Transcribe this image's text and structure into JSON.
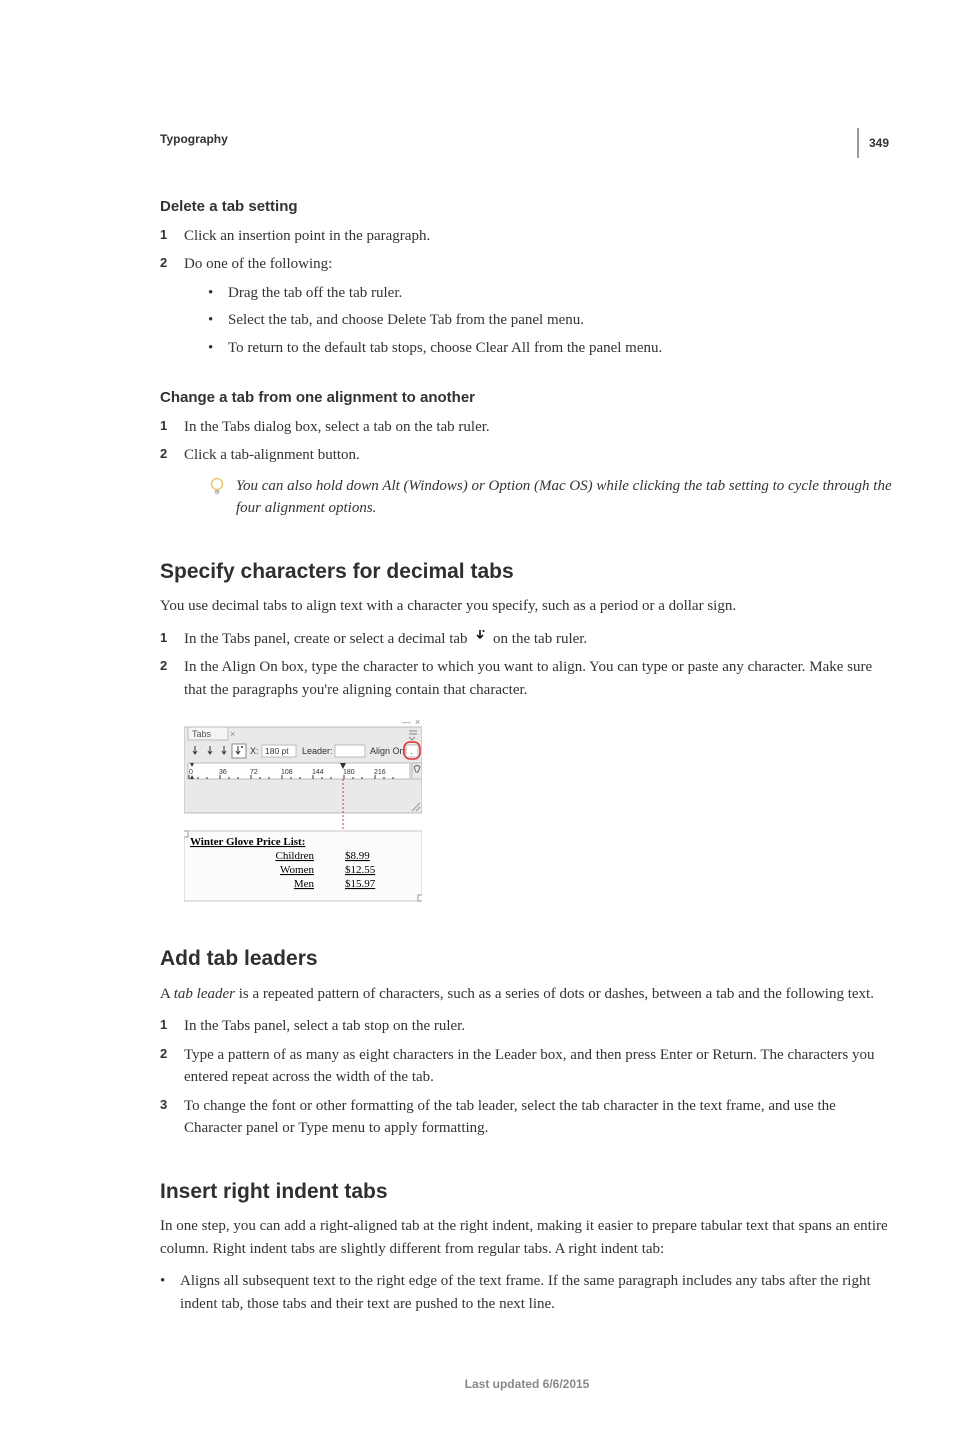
{
  "pageNumber": "349",
  "breadcrumb": "Typography",
  "s1": {
    "title": "Delete a tab setting",
    "step1": "Click an insertion point in the paragraph.",
    "step2": "Do one of the following:",
    "b1": "Drag the tab off the tab ruler.",
    "b2": "Select the tab, and choose Delete Tab from the panel menu.",
    "b3": "To return to the default tab stops, choose Clear All from the panel menu."
  },
  "s2": {
    "title": "Change a tab from one alignment to another",
    "step1": "In the Tabs dialog box, select a tab on the tab ruler.",
    "step2": "Click a tab-alignment button.",
    "tip": "You can also hold down Alt (Windows) or Option (Mac OS) while clicking the tab setting to cycle through the four alignment options."
  },
  "s3": {
    "title": "Specify characters for decimal tabs",
    "intro": "You use decimal tabs to align text with a character you specify, such as a period or a dollar sign.",
    "step1a": "In the Tabs panel, create or select a decimal tab ",
    "step1b": " on the tab ruler.",
    "step2": "In the Align On box, type the character to which you want to align. You can type or paste any character. Make sure that the paragraphs you're aligning contain that character.",
    "panel": {
      "tabLabel": "Tabs",
      "xLabel": "X:",
      "xValue": "180 pt",
      "leaderLabel": "Leader:",
      "alignOnLabel": "Align On:",
      "alignOnValue": ".",
      "ticks": [
        "0",
        "36",
        "72",
        "108",
        "144",
        "180",
        "216"
      ],
      "previewTitle": "Winter Glove Price List:",
      "rows": [
        {
          "label": "Children",
          "price": "$8.99"
        },
        {
          "label": "Women",
          "price": "$12.55"
        },
        {
          "label": "Men",
          "price": "$15.97"
        }
      ]
    }
  },
  "s4": {
    "title": "Add tab leaders",
    "intro_a": "A ",
    "intro_term": "tab leader",
    "intro_b": " is a repeated pattern of characters, such as a series of dots or dashes, between a tab and the following text.",
    "step1": "In the Tabs panel, select a tab stop on the ruler.",
    "step2": "Type a pattern of as many as eight characters in the Leader box, and then press Enter or Return. The characters you entered repeat across the width of the tab.",
    "step3": "To change the font or other formatting of the tab leader, select the tab character in the text frame, and use the Character panel or Type menu to apply formatting."
  },
  "s5": {
    "title": "Insert right indent tabs",
    "intro": "In one step, you can add a right-aligned tab at the right indent, making it easier to prepare tabular text that spans an entire column. Right indent tabs are slightly different from regular tabs. A right indent tab:",
    "b1": "Aligns all subsequent text to the right edge of the text frame. If the same paragraph includes any tabs after the right indent tab, those tabs and their text are pushed to the next line."
  },
  "footer": "Last updated 6/6/2015"
}
